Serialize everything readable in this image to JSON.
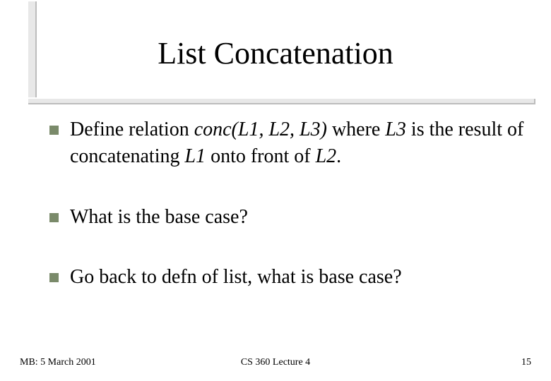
{
  "title": "List Concatenation",
  "bullets": {
    "b1_pre": "Define relation ",
    "b1_ital1": "conc(L1, L2, L3)",
    "b1_mid1": " where ",
    "b1_ital2": "L3",
    "b1_mid2": " is the result of concatenating ",
    "b1_ital3": "L1",
    "b1_mid3": " onto front of ",
    "b1_ital4": "L2",
    "b1_end": ".",
    "b2": "What is the base case?",
    "b3": "Go back to defn of list, what is base case?"
  },
  "footer": {
    "left": "MB: 5 March 2001",
    "center": "CS 360  Lecture 4",
    "right": "15"
  }
}
